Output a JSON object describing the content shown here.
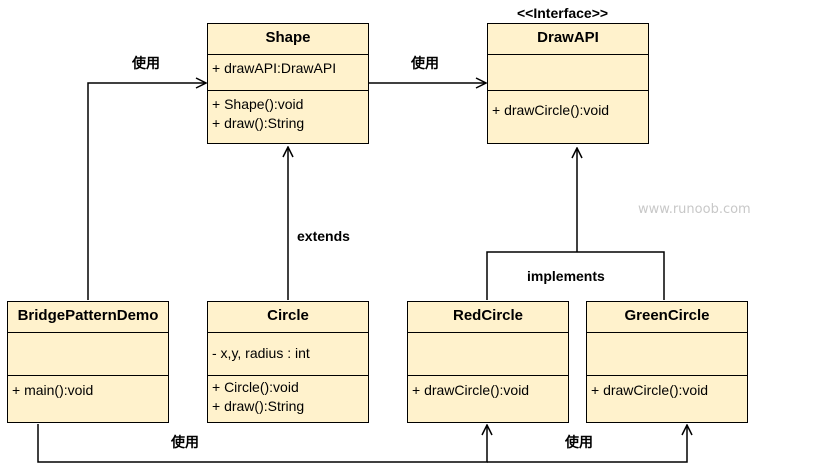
{
  "classes": {
    "shape": {
      "name": "Shape",
      "attributes": [
        "+ drawAPI:DrawAPI"
      ],
      "methods": [
        "+ Shape():void",
        "+ draw():String"
      ]
    },
    "drawapi": {
      "stereotype": "<<Interface>>",
      "name": "DrawAPI",
      "attributes": [],
      "methods": [
        "+ drawCircle():void"
      ]
    },
    "bridge": {
      "name": "BridgePatternDemo",
      "attributes": [],
      "methods": [
        "+ main():void"
      ]
    },
    "circle": {
      "name": "Circle",
      "attributes": [
        "- x,y, radius : int"
      ],
      "methods": [
        "+ Circle():void",
        "+ draw():String"
      ]
    },
    "red": {
      "name": "RedCircle",
      "attributes": [],
      "methods": [
        "+ drawCircle():void"
      ]
    },
    "green": {
      "name": "GreenCircle",
      "attributes": [],
      "methods": [
        "+ drawCircle():void"
      ]
    }
  },
  "labels": {
    "use_top_left": "使用",
    "use_top_right": "使用",
    "extends": "extends",
    "implements": "implements",
    "use_bottom_left": "使用",
    "use_bottom_right": "使用"
  },
  "watermark": "www.runoob.com",
  "colors": {
    "class_fill": "#fff2cc",
    "line": "#000000",
    "watermark": "#c8c8c8"
  }
}
